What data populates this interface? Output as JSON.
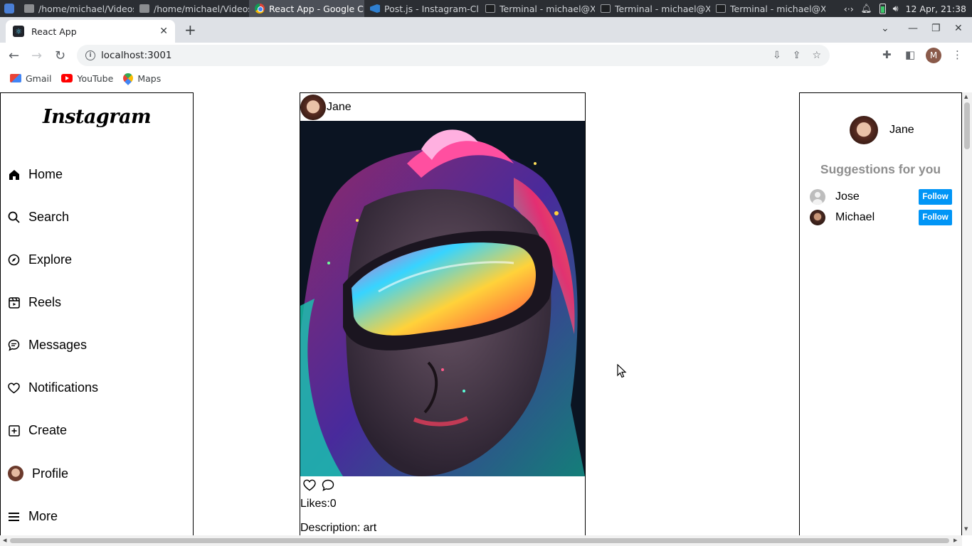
{
  "taskbar": {
    "tasks": [
      {
        "label": "/home/michael/Videos",
        "icon": "folder-icon"
      },
      {
        "label": "/home/michael/Videos",
        "icon": "folder-icon"
      },
      {
        "label": "React App - Google C...",
        "icon": "chrome-icon"
      },
      {
        "label": "Post.js - Instagram-Cl...",
        "icon": "vscode-icon"
      },
      {
        "label": "Terminal - michael@X...",
        "icon": "terminal-icon"
      },
      {
        "label": "Terminal - michael@X...",
        "icon": "terminal-icon"
      },
      {
        "label": "Terminal - michael@X...",
        "icon": "terminal-icon"
      }
    ],
    "clock": "12 Apr, 21:38"
  },
  "browser": {
    "tab_title": "React App",
    "url": "localhost:3001",
    "profile_initial": "M",
    "bookmarks": [
      "Gmail",
      "YouTube",
      "Maps"
    ]
  },
  "sidebar": {
    "logo": "Instagram",
    "items": [
      {
        "label": "Home",
        "icon": "home-icon"
      },
      {
        "label": "Search",
        "icon": "search-icon"
      },
      {
        "label": "Explore",
        "icon": "compass-icon"
      },
      {
        "label": "Reels",
        "icon": "reels-icon"
      },
      {
        "label": "Messages",
        "icon": "message-icon"
      },
      {
        "label": "Notifications",
        "icon": "heart-icon"
      },
      {
        "label": "Create",
        "icon": "plus-square-icon"
      },
      {
        "label": "Profile",
        "icon": "avatar"
      },
      {
        "label": "More",
        "icon": "menu-icon"
      }
    ]
  },
  "post": {
    "author": "Jane",
    "likes": "Likes:0",
    "description_label": "Description:",
    "description_text": "art"
  },
  "right_panel": {
    "username": "Jane",
    "suggestions_title": "Suggestions for you",
    "suggestions": [
      {
        "name": "Jose",
        "button": "Follow"
      },
      {
        "name": "Michael",
        "button": "Follow"
      }
    ]
  },
  "colors": {
    "follow_button": "#0095f6",
    "suggestions_title": "#8e8e8e"
  }
}
